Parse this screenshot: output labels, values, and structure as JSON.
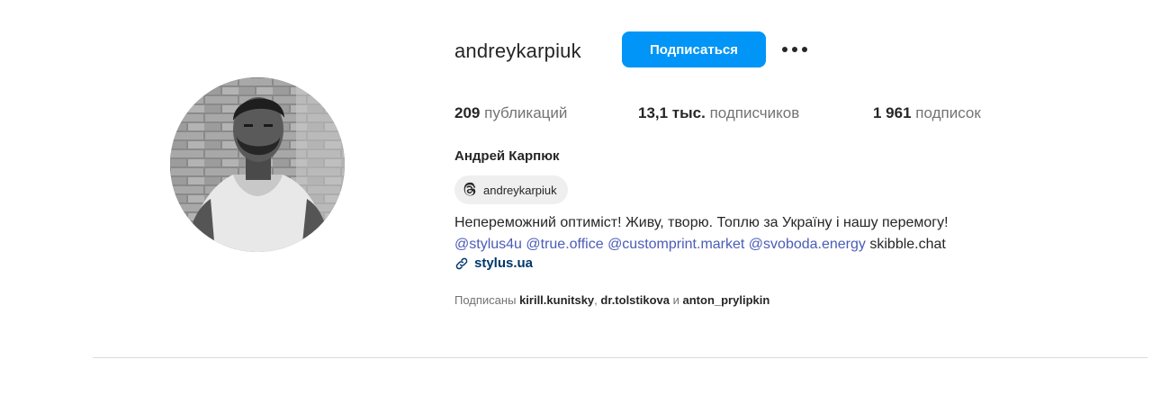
{
  "profile": {
    "username": "andreykarpiuk",
    "follow_label": "Подписаться",
    "more_label": "•••",
    "full_name": "Андрей Карпюк",
    "threads_handle": "andreykarpiuk"
  },
  "stats": {
    "posts": {
      "value": "209",
      "label": "публикаций"
    },
    "followers": {
      "value": "13,1 тыс.",
      "label": "подписчиков"
    },
    "following": {
      "value": "1 961",
      "label": "подписок"
    }
  },
  "bio": {
    "line1": "Непереможний оптиміст! Живу, творю. Топлю за Україну і нашу перемогу!",
    "mentions": [
      "@stylus4u",
      "@true.office",
      "@customprint.market",
      "@svoboda.energy"
    ],
    "plain_tail": "skibble.chat",
    "link": "stylus.ua"
  },
  "followed_by": {
    "prefix": "Подписаны",
    "user1": "kirill.kunitsky",
    "sep1": ",",
    "user2": "dr.tolstikova",
    "conj": "и",
    "user3": "anton_prylipkin"
  },
  "icons": {
    "threads": "threads-icon",
    "link": "link-icon",
    "more": "more-options-icon"
  },
  "colors": {
    "primary_button": "#0095f6",
    "mention": "#4a5cb8",
    "link": "#00376b",
    "secondary_text": "#737373"
  }
}
